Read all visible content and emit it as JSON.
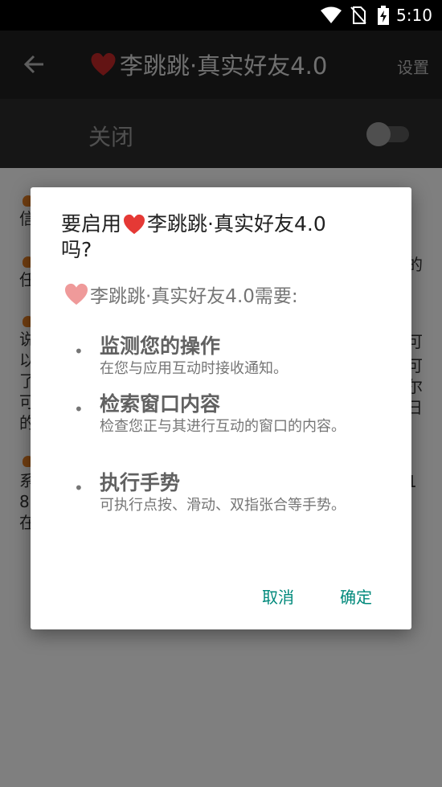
{
  "status_bar": {
    "time": "5:10",
    "icons": [
      "wifi-icon",
      "no-sim-icon",
      "battery-charging-icon"
    ]
  },
  "app_bar": {
    "back_icon": "arrow-left-icon",
    "title": "李跳跳·真实好友4.0",
    "title_icon": "heart-icon",
    "settings_label": "设置"
  },
  "switch_bar": {
    "label": "关闭",
    "state": "off"
  },
  "background_fragments": {
    "left_chars": [
      "信",
      "任",
      "说",
      "以",
      "了",
      "可",
      "的",
      "系",
      "8",
      "在"
    ],
    "right_chars": [
      "的",
      "可",
      "可",
      "尔",
      "日",
      "1"
    ]
  },
  "dialog": {
    "title_prefix": "要启用",
    "title_app": "李跳跳·真实好友4.0",
    "title_suffix": "吗?",
    "requires_text": "李跳跳·真实好友4.0需要:",
    "permissions": [
      {
        "bullet": "•",
        "title": "监测您的操作",
        "desc": "在您与应用互动时接收通知。"
      },
      {
        "bullet": "•",
        "title": "检索窗口内容",
        "desc": "检查您正与其进行互动的窗口的内容。"
      },
      {
        "bullet": "•",
        "title": "执行手势",
        "desc": "可执行点按、滑动、双指张合等手势。"
      }
    ],
    "cancel_label": "取消",
    "ok_label": "确定"
  },
  "colors": {
    "app_bar": "#212121",
    "switch_bar": "#2d2d2d",
    "heart": "#e53935",
    "heart_faded": "#ef9a9a",
    "accent": "#00897b"
  }
}
